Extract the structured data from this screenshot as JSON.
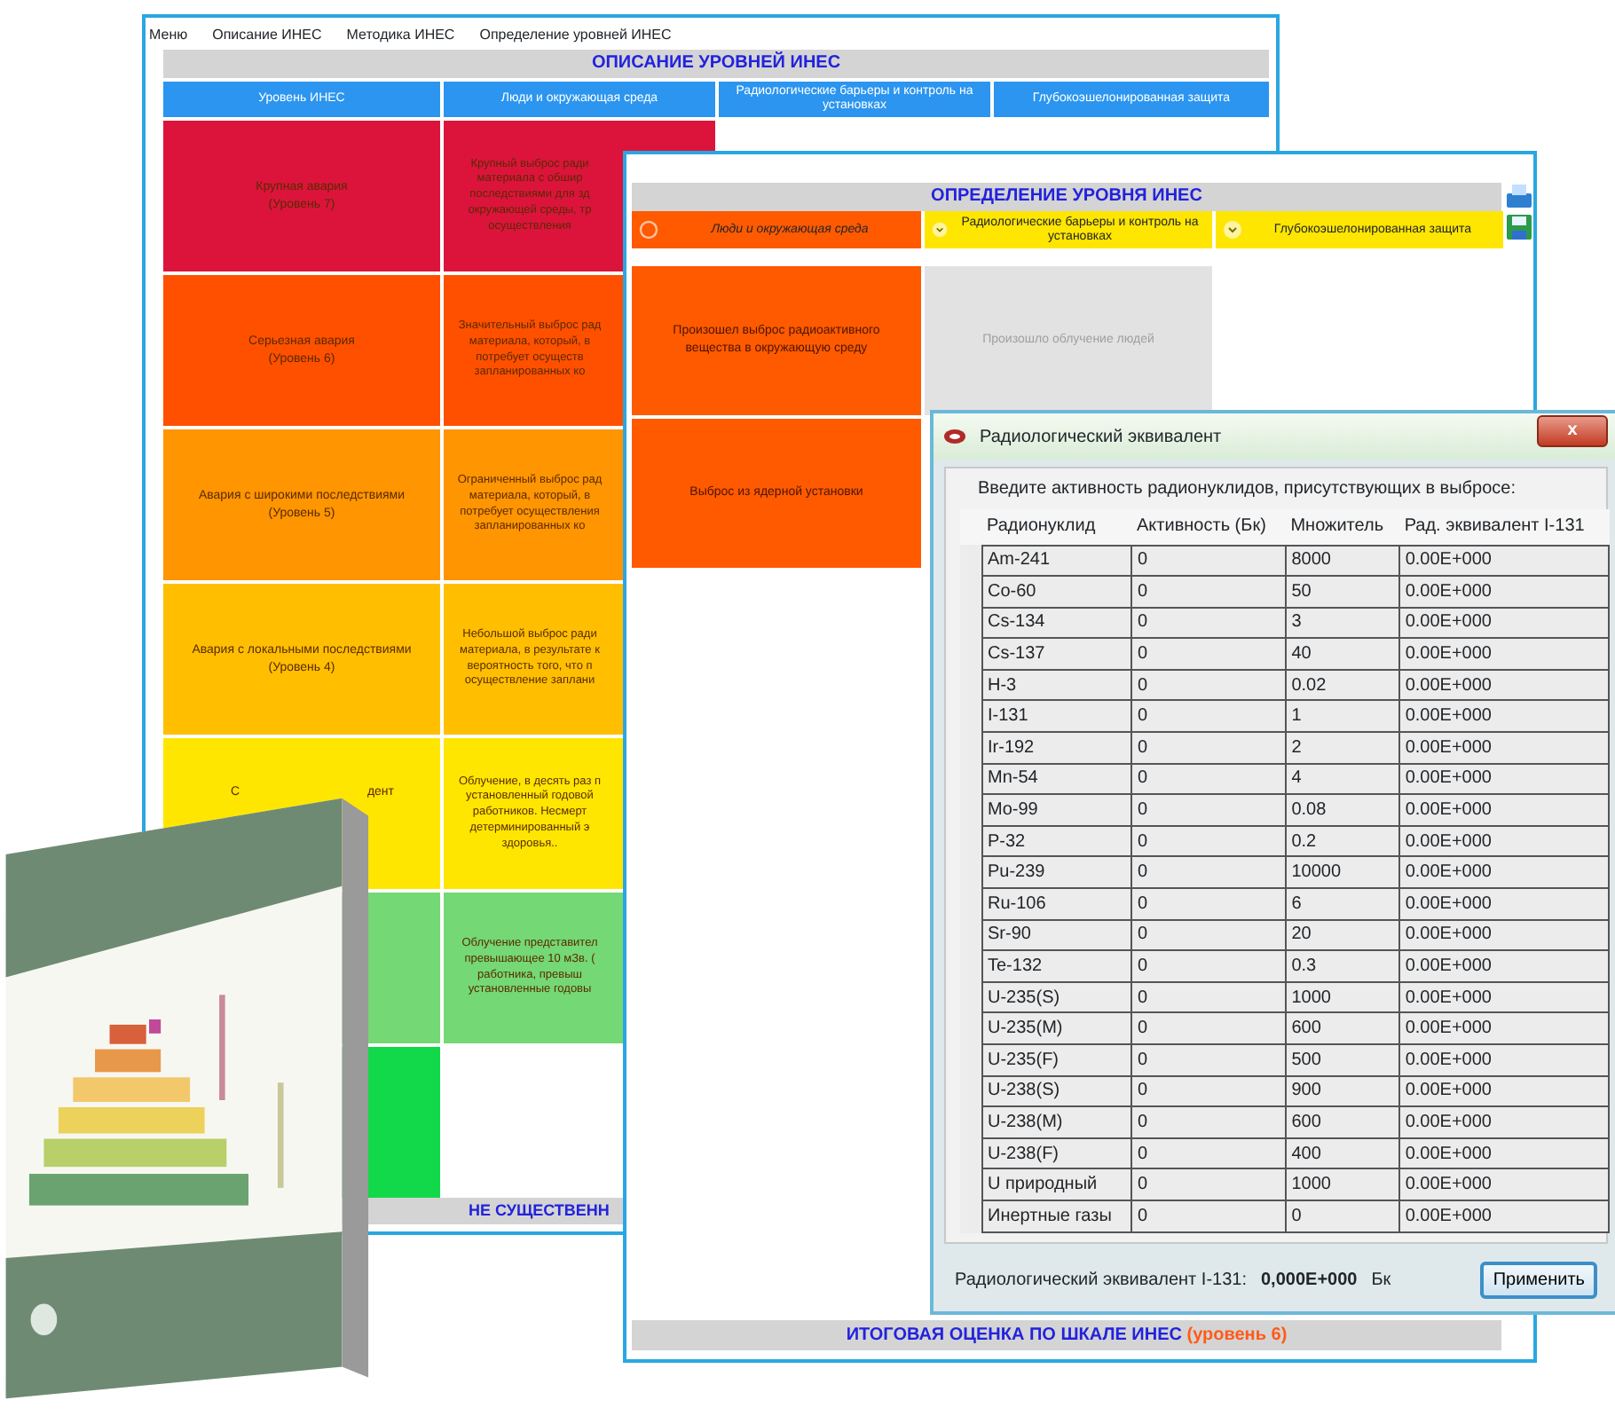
{
  "description_window": {
    "menu": [
      "Меню",
      "Описание ИНЕС",
      "Методика ИНЕС",
      "Определение уровней ИНЕС"
    ],
    "title": "ОПИСАНИЕ УРОВНЕЙ ИНЕС",
    "columns": [
      "Уровень ИНЕС",
      "Люди и окружающая среда",
      "Радиологические барьеры и контроль на установках",
      "Глубокоэшелонированная защита"
    ],
    "rows": [
      {
        "label": [
          "Крупная авария",
          "(Уровень 7)"
        ],
        "people": [
          "Крупный выброс ради",
          "материала с обшир",
          "последствиями для зд",
          "окружающей среды, тр",
          "осуществления"
        ],
        "color": "#dc143c"
      },
      {
        "label": [
          "Серьезная авария",
          "(Уровень 6)"
        ],
        "people": [
          "Значительный выброс рад",
          "материала, который, в",
          "потребует осуществ",
          "запланированных ко"
        ],
        "color": "#ff5000"
      },
      {
        "label": [
          "Авария с широкими последствиями",
          "(Уровень 5)"
        ],
        "people": [
          "Ограниченный выброс рад",
          "материала, который, в",
          "потребует осуществления",
          "запланированных ко"
        ],
        "color": "#ff9500"
      },
      {
        "label": [
          "Авария с локальными последствиями",
          "(Уровень 4)"
        ],
        "people": [
          "Небольшой выброс ради",
          "материала, в результате к",
          "вероятность того, что п",
          "осуществление заплани"
        ],
        "color": "#ffbf00"
      },
      {
        "label_parts": [
          "С",
          "дент"
        ],
        "people": [
          "Облучение, в десять раз п",
          "установленный годовой",
          "работников. Несмерт",
          "детерминированный э",
          "здоровья.."
        ],
        "color": "#ffe600"
      },
      {
        "people": [
          "Облучение представител",
          "превышающее 10 мЗв. (",
          "работника, превыш",
          "установленные годовы"
        ],
        "color": "#74d874"
      },
      {
        "color": "#12d94a"
      }
    ],
    "footer": "НЕ СУЩЕСТВЕНН"
  },
  "determination_window": {
    "title": "ОПРЕДЕЛЕНИЕ УРОВНЯ ИНЕС",
    "columns": [
      {
        "label": "Люди и окружающая среда",
        "selected": true
      },
      {
        "label": "Радиологические барьеры и контроль на установках",
        "selected": false
      },
      {
        "label": "Глубокоэшелонированная защита",
        "selected": false
      }
    ],
    "cells": [
      {
        "text": "Произошел выброс радиоактивного вещества в окружающую среду",
        "kind": "option"
      },
      {
        "text": "Произошло облучение людей",
        "kind": "disabled"
      },
      {
        "text": "Выброс из ядерной установки",
        "kind": "option"
      }
    ],
    "result": {
      "text": "ИТОГОВАЯ ОЦЕНКА ПО ШКАЛЕ ИНЕС",
      "level_text": "(уровень 6)"
    }
  },
  "dialog": {
    "title": "Радиологический эквивалент",
    "close": "x",
    "prompt": "Введите активность радионуклидов, присутствующих в выбросе:",
    "columns": [
      "Радионуклид",
      "Активность (Бк)",
      "Множитель",
      "Рад. эквивалент I-131"
    ],
    "rows": [
      [
        "Am-241",
        "0",
        "8000",
        "0.00E+000"
      ],
      [
        "Co-60",
        "0",
        "50",
        "0.00E+000"
      ],
      [
        "Cs-134",
        "0",
        "3",
        "0.00E+000"
      ],
      [
        "Cs-137",
        "0",
        "40",
        "0.00E+000"
      ],
      [
        "H-3",
        "0",
        "0.02",
        "0.00E+000"
      ],
      [
        "I-131",
        "0",
        "1",
        "0.00E+000"
      ],
      [
        "Ir-192",
        "0",
        "2",
        "0.00E+000"
      ],
      [
        "Mn-54",
        "0",
        "4",
        "0.00E+000"
      ],
      [
        "Mo-99",
        "0",
        "0.08",
        "0.00E+000"
      ],
      [
        "P-32",
        "0",
        "0.2",
        "0.00E+000"
      ],
      [
        "Pu-239",
        "0",
        "10000",
        "0.00E+000"
      ],
      [
        "Ru-106",
        "0",
        "6",
        "0.00E+000"
      ],
      [
        "Sr-90",
        "0",
        "20",
        "0.00E+000"
      ],
      [
        "Te-132",
        "0",
        "0.3",
        "0.00E+000"
      ],
      [
        "U-235(S)",
        "0",
        "1000",
        "0.00E+000"
      ],
      [
        "U-235(M)",
        "0",
        "600",
        "0.00E+000"
      ],
      [
        "U-235(F)",
        "0",
        "500",
        "0.00E+000"
      ],
      [
        "U-238(S)",
        "0",
        "900",
        "0.00E+000"
      ],
      [
        "U-238(M)",
        "0",
        "600",
        "0.00E+000"
      ],
      [
        "U-238(F)",
        "0",
        "400",
        "0.00E+000"
      ],
      [
        "U природный",
        "0",
        "1000",
        "0.00E+000"
      ],
      [
        "Инертные газы",
        "0",
        "0",
        "0.00E+000"
      ]
    ],
    "total_label": "Радиологический эквивалент I-131:",
    "total_value": "0,000E+000",
    "total_unit": "Бк",
    "apply": "Применить"
  }
}
